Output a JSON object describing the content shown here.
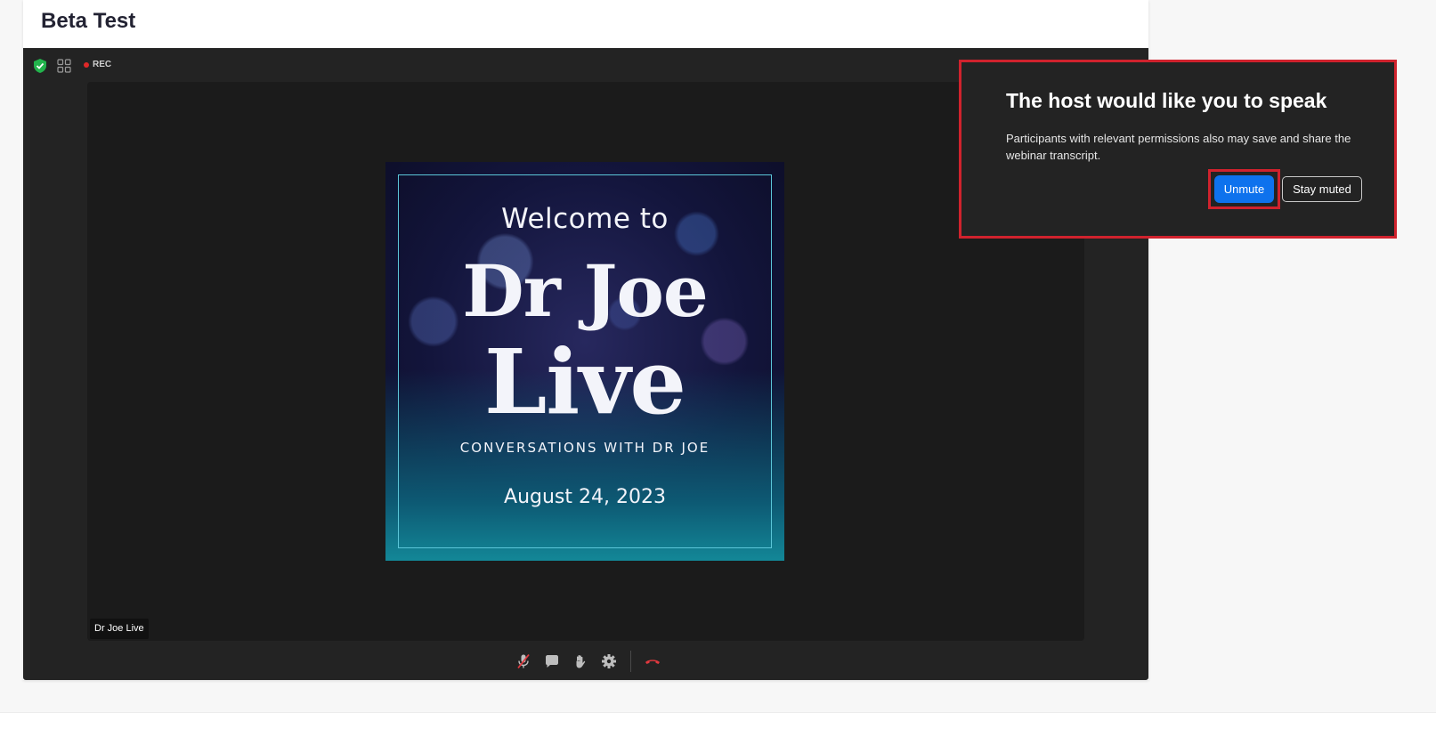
{
  "page": {
    "title": "Beta Test"
  },
  "meeting_topbar": {
    "rec_label": "REC"
  },
  "shared_content": {
    "welcome": "Welcome to",
    "line1": "Dr Joe",
    "line2": "Live",
    "subtitle": "CONVERSATIONS WITH DR JOE",
    "date": "August 24, 2023"
  },
  "participant": {
    "name": "Dr Joe Live"
  },
  "controls": {
    "icons": [
      "mic-muted-icon",
      "chat-icon",
      "raise-hand-icon",
      "settings-icon",
      "leave-icon"
    ]
  },
  "dialog": {
    "title": "The host would like you to speak",
    "body": "Participants with relevant permissions also may save and share the webinar transcript.",
    "unmute_label": "Unmute",
    "stay_muted_label": "Stay muted"
  },
  "colors": {
    "accent_blue": "#0e72ed",
    "highlight_red": "#d0222d",
    "meeting_bg": "#232323",
    "leave_red": "#e0383e",
    "shield_green": "#22b34c"
  }
}
